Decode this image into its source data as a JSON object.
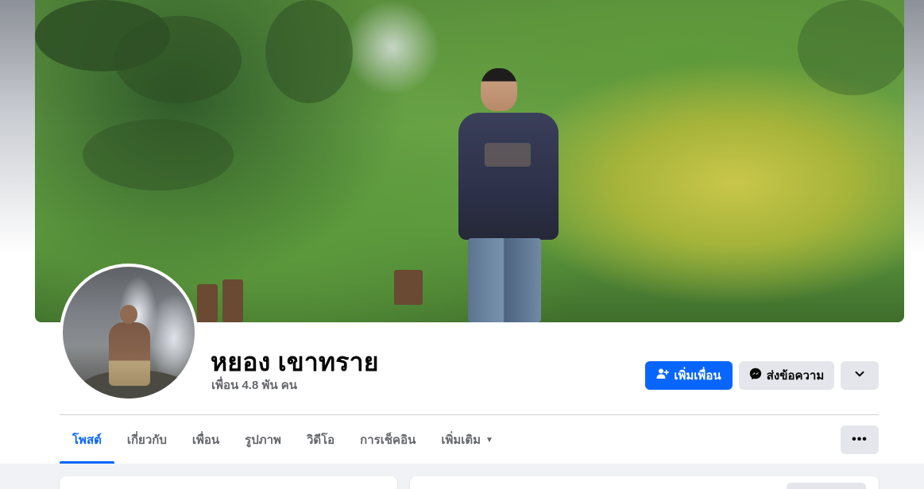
{
  "profile": {
    "name": "หยอง เขาทราย",
    "friends_count": "เพื่อน 4.8 พัน คน"
  },
  "actions": {
    "add_friend_label": "เพิ่มเพื่อน",
    "message_label": "ส่งข้อความ"
  },
  "tabs": [
    {
      "label": "โพสต์",
      "active": true
    },
    {
      "label": "เกี่ยวกับ"
    },
    {
      "label": "เพื่อน"
    },
    {
      "label": "รูปภาพ"
    },
    {
      "label": "วิดีโอ"
    },
    {
      "label": "การเช็คอิน"
    },
    {
      "label": "เพิ่มเติม"
    }
  ],
  "icons": {
    "add_friend": "add-friend-icon",
    "messenger": "messenger-icon",
    "chevron": "chevron-down-icon",
    "more_caret": "caret-down-icon",
    "dots": "more-options-icon"
  },
  "colors": {
    "accent": "#0866ff",
    "secondary_button": "#e4e6eb",
    "text_primary": "#050505",
    "text_secondary": "#65676b",
    "feed_background": "#f0f2f5"
  }
}
